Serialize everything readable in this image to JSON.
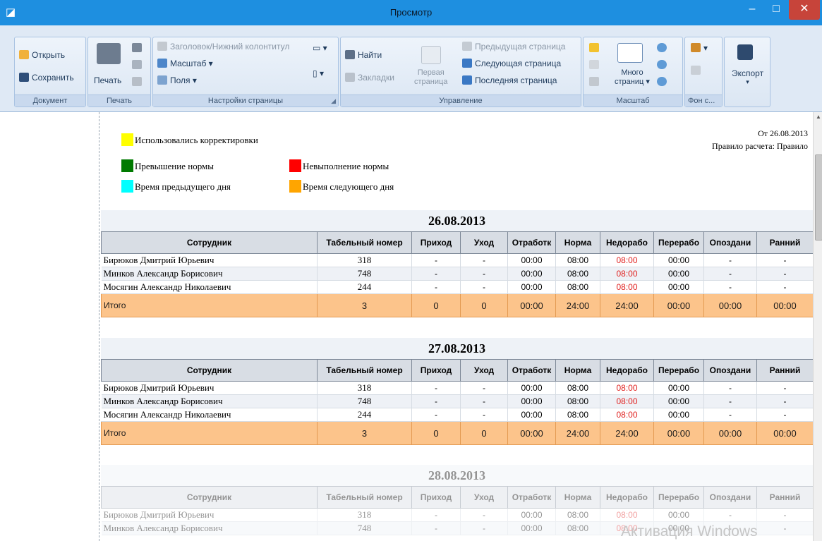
{
  "window": {
    "title": "Просмотр",
    "minimize": "–",
    "maximize": "□",
    "close": "✕"
  },
  "ribbon": {
    "document": {
      "label": "Документ",
      "open": "Открыть",
      "save": "Сохранить"
    },
    "print": {
      "label": "Печать",
      "print": "Печать"
    },
    "page_setup": {
      "label": "Настройки страницы",
      "header_footer": "Заголовок/Нижний колонтитул",
      "scale": "Масштаб ▾",
      "margins": "Поля ▾"
    },
    "navigation": {
      "label": "Управление",
      "find": "Найти",
      "bookmarks": "Закладки",
      "first_page_line1": "Первая",
      "first_page_line2": "страница",
      "prev_page": "Предыдущая страница",
      "next_page": "Следующая страница",
      "last_page": "Последняя страница"
    },
    "zoom": {
      "label": "Масштаб",
      "many_pages_line1": "Много",
      "many_pages_line2": "страниц ▾"
    },
    "background": {
      "label": "Фон с..."
    },
    "export": {
      "label": "Экспорт"
    }
  },
  "legend": {
    "corrections": "Использовались корректировки",
    "over_norm": "Превышение нормы",
    "under_norm": "Невыполнение нормы",
    "prev_day": "Время предыдущего дня",
    "next_day": "Время следующего дня",
    "colors": {
      "corrections": "#ffff00",
      "over_norm": "#007a00",
      "under_norm": "#ff0000",
      "prev_day": "#00ffff",
      "next_day": "#ffa500"
    }
  },
  "header_right": {
    "date": "От 26.08.2013",
    "rule": "Правило расчета: Правило"
  },
  "columns": [
    "Сотрудник",
    "Табельный номер",
    "Приход",
    "Уход",
    "Отработк",
    "Норма",
    "Недорабо",
    "Перерабо",
    "Опоздани",
    "Ранний"
  ],
  "days": [
    {
      "date": "26.08.2013",
      "rows": [
        [
          "Бирюков Дмитрий Юрьевич",
          "318",
          "-",
          "-",
          "00:00",
          "08:00",
          "08:00",
          "00:00",
          "-",
          "-"
        ],
        [
          "Минков Александр Борисович",
          "748",
          "-",
          "-",
          "00:00",
          "08:00",
          "08:00",
          "00:00",
          "-",
          "-"
        ],
        [
          "Мосягин Александр Николаевич",
          "244",
          "-",
          "-",
          "00:00",
          "08:00",
          "08:00",
          "00:00",
          "-",
          "-"
        ]
      ],
      "total": [
        "Итого",
        "3",
        "0",
        "0",
        "00:00",
        "24:00",
        "24:00",
        "00:00",
        "00:00",
        "00:00"
      ]
    },
    {
      "date": "27.08.2013",
      "rows": [
        [
          "Бирюков Дмитрий Юрьевич",
          "318",
          "-",
          "-",
          "00:00",
          "08:00",
          "08:00",
          "00:00",
          "-",
          "-"
        ],
        [
          "Минков Александр Борисович",
          "748",
          "-",
          "-",
          "00:00",
          "08:00",
          "08:00",
          "00:00",
          "-",
          "-"
        ],
        [
          "Мосягин Александр Николаевич",
          "244",
          "-",
          "-",
          "00:00",
          "08:00",
          "08:00",
          "00:00",
          "-",
          "-"
        ]
      ],
      "total": [
        "Итого",
        "3",
        "0",
        "0",
        "00:00",
        "24:00",
        "24:00",
        "00:00",
        "00:00",
        "00:00"
      ]
    },
    {
      "date": "28.08.2013",
      "rows": [
        [
          "Бирюков Дмитрий Юрьевич",
          "318",
          "-",
          "-",
          "00:00",
          "08:00",
          "08:00",
          "00:00",
          "-",
          "-"
        ],
        [
          "Минков Александр Борисович",
          "748",
          "-",
          "-",
          "00:00",
          "08:00",
          "08:00",
          "00:00",
          "-",
          "-"
        ]
      ]
    }
  ],
  "watermark": "Активация Windows"
}
